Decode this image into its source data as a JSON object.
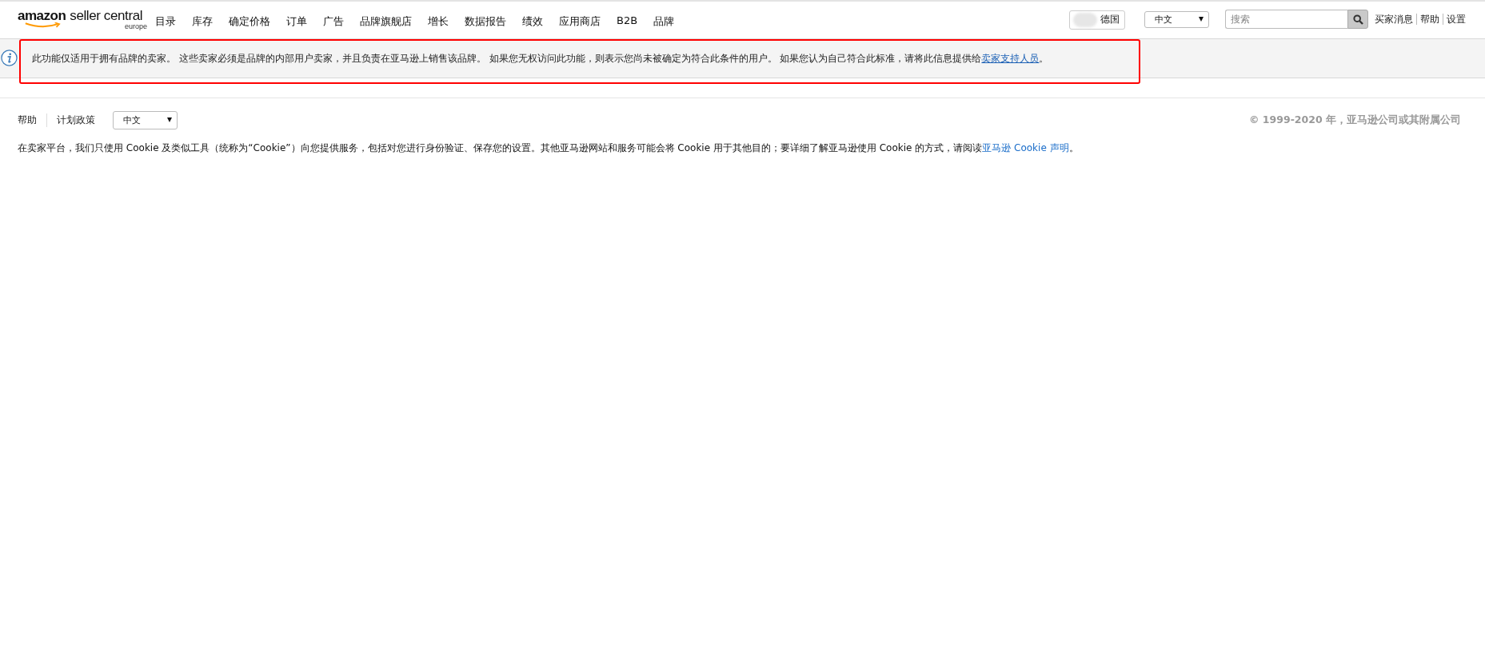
{
  "header": {
    "logo": {
      "name": "amazon",
      "product": "seller central",
      "region": "europe"
    },
    "nav": [
      "目录",
      "库存",
      "确定价格",
      "订单",
      "广告",
      "品牌旗舰店",
      "增长",
      "数据报告",
      "绩效",
      "应用商店",
      "B2B",
      "品牌"
    ],
    "marketplace": {
      "label": "德国"
    },
    "language": {
      "value": "中文"
    },
    "search": {
      "placeholder": "搜索"
    },
    "links": [
      "买家消息",
      "帮助",
      "设置"
    ]
  },
  "notice": {
    "highlighted": true,
    "text": "此功能仅适用于拥有品牌的卖家。 这些卖家必须是品牌的内部用户卖家，并且负责在亚马逊上销售该品牌。 如果您无权访问此功能，则表示您尚未被确定为符合此条件的用户。 如果您认为自己符合此标准，请将此信息提供给",
    "link": "卖家支持人员",
    "after": "。"
  },
  "footer": {
    "links": [
      "帮助",
      "计划政策"
    ],
    "language": {
      "value": "中文"
    },
    "copyright": "© 1999-2020 年，亚马逊公司或其附属公司",
    "cookie": {
      "text": "在卖家平台，我们只使用 Cookie 及类似工具（统称为“Cookie”）向您提供服务，包括对您进行身份验证、保存您的设置。其他亚马逊网站和服务可能会将 Cookie 用于其他目的；要详细了解亚马逊使用 Cookie 的方式，请阅读",
      "link": "亚马逊 Cookie 声明",
      "after": "。"
    }
  }
}
